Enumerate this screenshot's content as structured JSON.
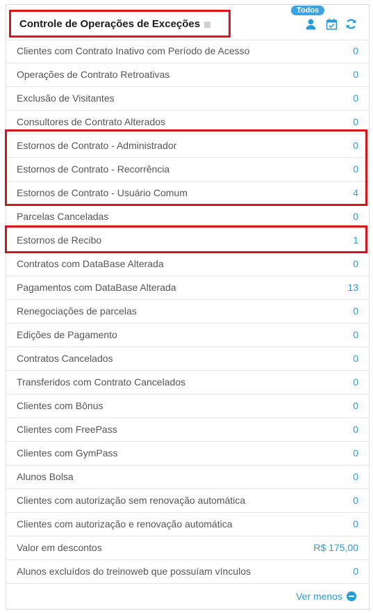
{
  "header": {
    "title": "Controle de Operações de Exceções",
    "filter_badge": "Todos",
    "icons": [
      "user-icon",
      "calendar-check-icon",
      "refresh-icon"
    ]
  },
  "colors": {
    "accent": "#2b9bd6",
    "highlight": "#d0161e"
  },
  "rows": [
    {
      "label": "Clientes com Contrato Inativo com Período de Acesso",
      "value": "0"
    },
    {
      "label": "Operações de Contrato Retroativas",
      "value": "0"
    },
    {
      "label": "Exclusão de Visitantes",
      "value": "0"
    },
    {
      "label": "Consultores de Contrato Alterados",
      "value": "0"
    },
    {
      "label": "Estornos de Contrato - Administrador",
      "value": "0"
    },
    {
      "label": "Estornos de Contrato - Recorrência",
      "value": "0"
    },
    {
      "label": "Estornos de Contrato - Usuário Comum",
      "value": "4"
    },
    {
      "label": "Parcelas Canceladas",
      "value": "0"
    },
    {
      "label": "Estornos de Recibo",
      "value": "1"
    },
    {
      "label": "Contratos com DataBase Alterada",
      "value": "0"
    },
    {
      "label": "Pagamentos com DataBase Alterada",
      "value": "13"
    },
    {
      "label": "Renegociações de parcelas",
      "value": "0"
    },
    {
      "label": "Edições de Pagamento",
      "value": "0"
    },
    {
      "label": "Contratos Cancelados",
      "value": "0"
    },
    {
      "label": "Transferidos com Contrato Cancelados",
      "value": "0"
    },
    {
      "label": "Clientes com Bônus",
      "value": "0"
    },
    {
      "label": "Clientes com FreePass",
      "value": "0"
    },
    {
      "label": "Clientes com GymPass",
      "value": "0"
    },
    {
      "label": "Alunos Bolsa",
      "value": "0"
    },
    {
      "label": "Clientes com autorização sem renovação automática",
      "value": "0"
    },
    {
      "label": "Clientes com autorização e renovação automática",
      "value": "0"
    },
    {
      "label": "Valor em descontos",
      "value": "R$ 175,00"
    },
    {
      "label": "Alunos excluídos do treinoweb que possuíam vínculos",
      "value": "0"
    }
  ],
  "footer": {
    "link_label": "Ver menos"
  }
}
